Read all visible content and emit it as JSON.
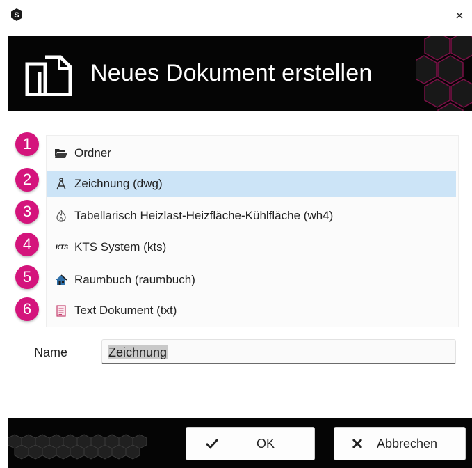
{
  "titlebar": {
    "close_glyph": "×",
    "app_icon": "app-logo-icon"
  },
  "header": {
    "title": "Neues Dokument erstellen",
    "icon": "documents-icon"
  },
  "document_types": [
    {
      "badge": "1",
      "label": "Ordner",
      "icon": "folder-icon",
      "selected": false
    },
    {
      "badge": "2",
      "label": "Zeichnung (dwg)",
      "icon": "compass-icon",
      "selected": true
    },
    {
      "badge": "3",
      "label": "Tabellarisch Heizlast-Heizfläche-Kühlfläche (wh4)",
      "icon": "flame-icon",
      "selected": false
    },
    {
      "badge": "4",
      "label": "KTS System (kts)",
      "icon": "kts-logo-icon",
      "icon_text": "KTS",
      "selected": false
    },
    {
      "badge": "5",
      "label": "Raumbuch (raumbuch)",
      "icon": "house-icon",
      "selected": false
    },
    {
      "badge": "6",
      "label": "Text Dokument (txt)",
      "icon": "text-document-icon",
      "selected": false
    }
  ],
  "name_field": {
    "label": "Name",
    "value": "Zeichnung"
  },
  "buttons": {
    "ok_label": "OK",
    "ok_icon": "checkmark-icon",
    "cancel_label": "Abbrechen",
    "cancel_icon": "x-icon"
  },
  "colors": {
    "badge": "#d4147c",
    "selection": "#cce4f7",
    "header_bg": "#050505",
    "hex_accent": "#b0175f"
  }
}
